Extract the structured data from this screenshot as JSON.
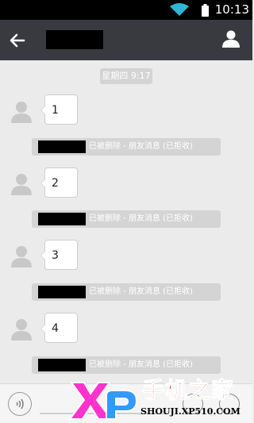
{
  "status_bar": {
    "time": "10:13"
  },
  "chat": {
    "timestamp": "星期四 9:17",
    "messages": [
      {
        "text": "1",
        "notice": "已被删除 - 朋友消息 (已拒收)"
      },
      {
        "text": "2",
        "notice": "已被删除 - 朋友消息 (已拒收)"
      },
      {
        "text": "3",
        "notice": "已被删除 - 朋友消息 (已拒收)"
      },
      {
        "text": "4",
        "notice": "已被删除 - 朋友消息 (已拒收)"
      }
    ]
  },
  "watermark": {
    "brand": "手机之家",
    "url": "SHOUJI.XP510.COM"
  },
  "colors": {
    "header": "#393a3f",
    "background": "#ebebeb",
    "notice": "#d4d4d4",
    "watermark_red": "#e32410",
    "watermark_pink": "#ff33cc",
    "watermark_blue": "#3399ff"
  },
  "icons": [
    "wifi-icon",
    "battery-icon",
    "back-arrow-icon",
    "profile-icon",
    "avatar-icon",
    "voice-icon",
    "emoji-icon",
    "plus-icon"
  ]
}
